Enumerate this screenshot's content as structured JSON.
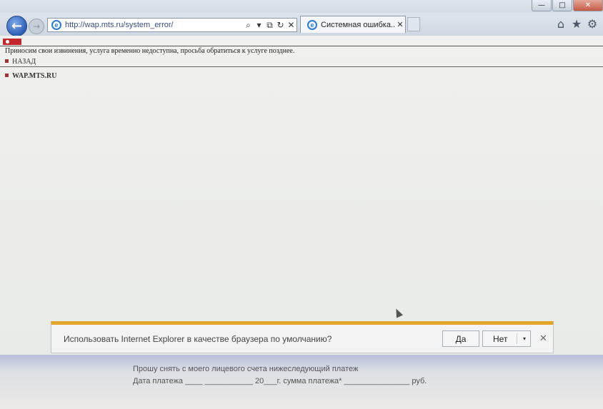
{
  "window": {
    "minimize_glyph": "—",
    "maximize_glyph": "□",
    "close_glyph": "✕"
  },
  "toolbar": {
    "back_glyph": "←",
    "forward_glyph": "→",
    "address_value": "http://wap.mts.ru/system_error/",
    "search_glyph": "⌕",
    "dropdown_glyph": "▾",
    "compat_glyph": "⧉",
    "refresh_glyph": "↻",
    "stop_glyph": "✕",
    "tab_label": "Системная ошибка...",
    "tab_close_glyph": "✕",
    "home_glyph": "⌂",
    "favorites_glyph": "★",
    "tools_glyph": "⚙"
  },
  "page": {
    "message": "Приносим свои извинения, услуга временно недоступна, просьба обратиться к услуге позднее.",
    "back_link": "НАЗАД",
    "home_link": "WAP.MTS.RU"
  },
  "notification": {
    "text": "Использовать Internet Explorer в качестве браузера по умолчанию?",
    "yes_label": "Да",
    "no_label": "Нет",
    "no_dropdown_glyph": "▾",
    "close_glyph": "✕"
  },
  "paper": {
    "line1": "Прошу снять с моего лицевого счета нижеследующий платеж",
    "line2": "Дата платежа ____ ___________ 20___г. сумма платежа* _______________ руб."
  },
  "colors": {
    "accent_bar": "#e0a52a",
    "mts_red": "#c1272d",
    "ie_blue": "#2b7bd0"
  }
}
